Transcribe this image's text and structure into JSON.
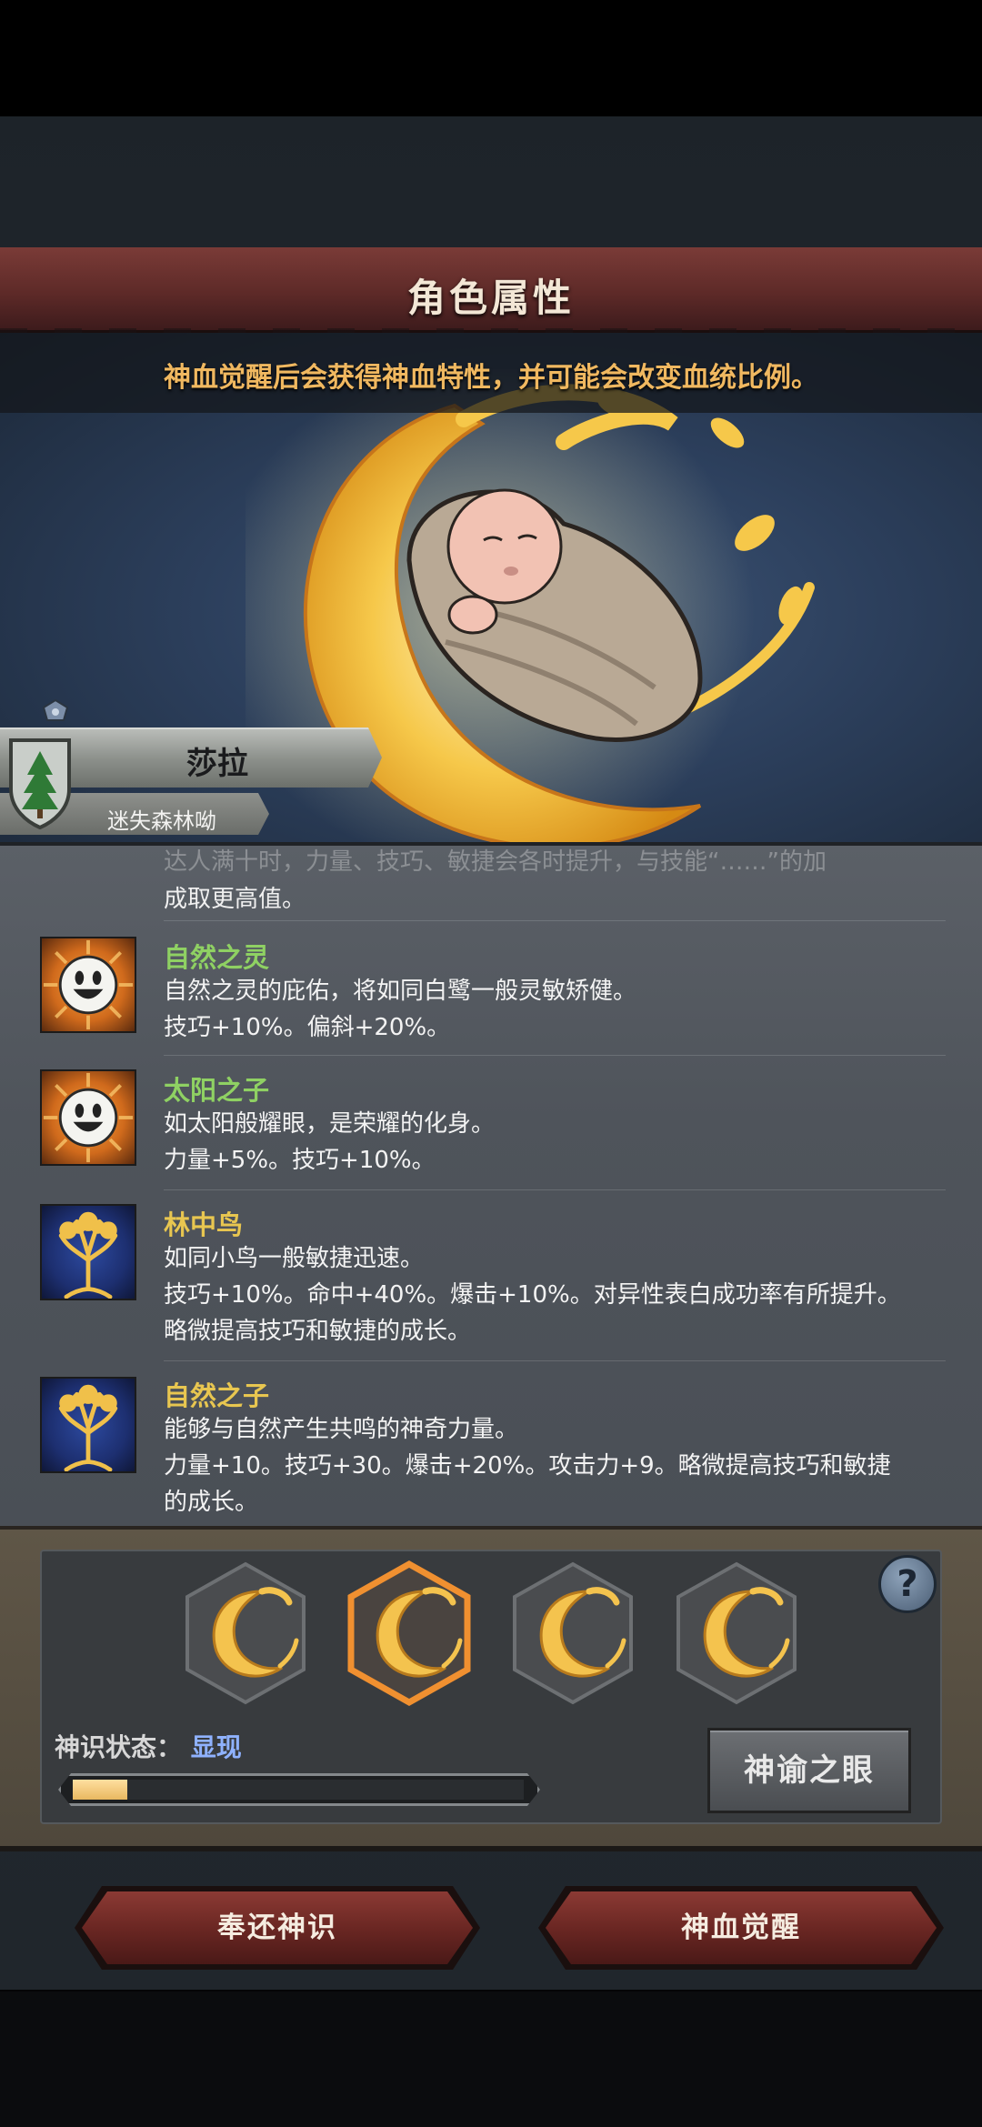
{
  "header": {
    "title": "角色属性"
  },
  "portrait": {
    "hint": "神血觉醒后会获得神血特性，并可能会改变血统比例。"
  },
  "character": {
    "name": "莎拉",
    "lineage": "迷失森林呦"
  },
  "traits_partial": {
    "faded_line": "达人满十时，力量、技巧、敏捷会各时提升，与技能“……”的加",
    "continuation": "成取更高值。"
  },
  "traits": [
    {
      "name": "自然之灵",
      "name_color": "green",
      "icon": "smiley-sun-icon",
      "lines": [
        "自然之灵的庇佑，将如同白鹭一般灵敏矫健。",
        "技巧+10%。偏斜+20%。"
      ]
    },
    {
      "name": "太阳之子",
      "name_color": "green",
      "icon": "smiley-sun-icon",
      "lines": [
        "如太阳般耀眼，是荣耀的化身。",
        "力量+5%。技巧+10%。"
      ]
    },
    {
      "name": "林中鸟",
      "name_color": "gold",
      "icon": "golden-tree-icon",
      "lines": [
        "如同小鸟一般敏捷迅速。",
        "技巧+10%。命中+40%。爆击+10%。对异性表白成功率有所提升。",
        "略微提高技巧和敏捷的成长。"
      ]
    },
    {
      "name": "自然之子",
      "name_color": "gold",
      "icon": "golden-tree-icon",
      "lines": [
        "能够与自然产生共鸣的神奇力量。",
        "力量+10。技巧+30。爆击+20%。攻击力+9。略微提高技巧和敏捷",
        "的成长。"
      ]
    }
  ],
  "godsense": {
    "label": "神识状态：",
    "state": "显现",
    "progress": 0.12,
    "slots": [
      "moon-branch-icon",
      "moon-branch-icon",
      "moon-branch-icon",
      "moon-branch-icon"
    ],
    "selected_slot": 1,
    "help": "?",
    "oracle_button": "神谕之眼"
  },
  "actions": {
    "return_button": "奉还神识",
    "awaken_button": "神血觉醒"
  },
  "colors": {
    "accent_red": "#6b2723",
    "green_name": "#8fd163",
    "gold_name": "#e8c650",
    "hint": "#f0b860"
  }
}
